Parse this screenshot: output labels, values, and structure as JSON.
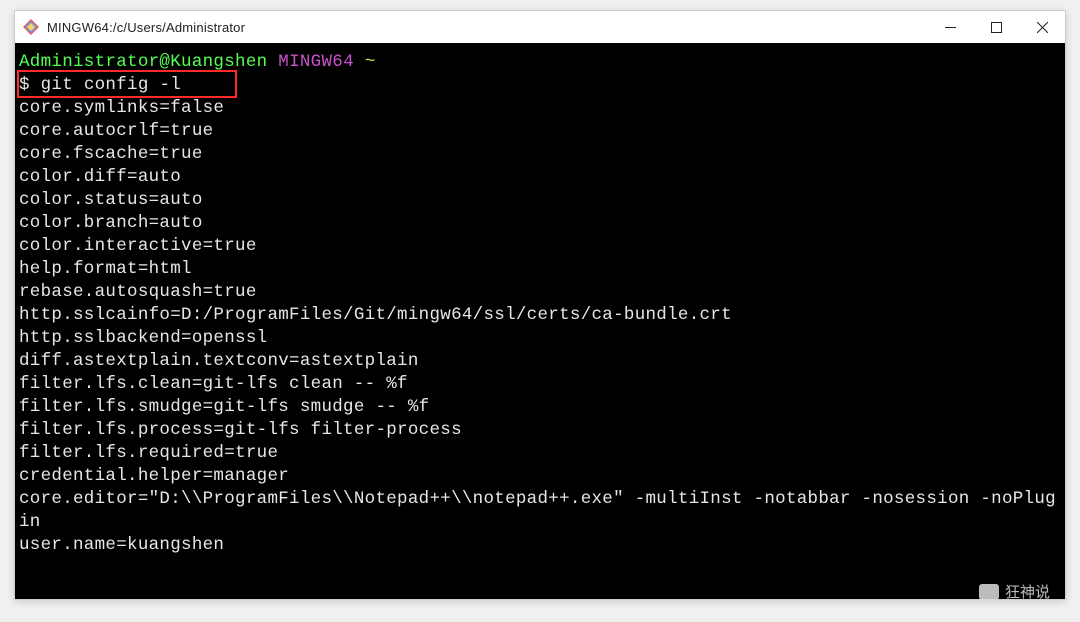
{
  "window": {
    "title": "MINGW64:/c/Users/Administrator"
  },
  "prompt": {
    "user_host": "Administrator@Kuangshen",
    "system": "MINGW64",
    "path": "~"
  },
  "command": {
    "symbol": "$",
    "text": "git config -l"
  },
  "output": [
    "core.symlinks=false",
    "core.autocrlf=true",
    "core.fscache=true",
    "color.diff=auto",
    "color.status=auto",
    "color.branch=auto",
    "color.interactive=true",
    "help.format=html",
    "rebase.autosquash=true",
    "http.sslcainfo=D:/ProgramFiles/Git/mingw64/ssl/certs/ca-bundle.crt",
    "http.sslbackend=openssl",
    "diff.astextplain.textconv=astextplain",
    "filter.lfs.clean=git-lfs clean -- %f",
    "filter.lfs.smudge=git-lfs smudge -- %f",
    "filter.lfs.process=git-lfs filter-process",
    "filter.lfs.required=true",
    "credential.helper=manager",
    "core.editor=\"D:\\\\ProgramFiles\\\\Notepad++\\\\notepad++.exe\" -multiInst -notabbar -nosession -noPlugin",
    "user.name=kuangshen"
  ],
  "watermark": {
    "text": "狂神说"
  }
}
